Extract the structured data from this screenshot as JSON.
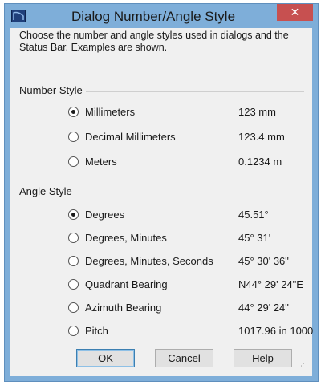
{
  "window": {
    "title": "Dialog Number/Angle Style",
    "close_label": "✕",
    "icon": "app-icon"
  },
  "description": "Choose the number and angle styles used in dialogs and the Status Bar.  Examples are shown.",
  "number_style": {
    "label": "Number Style",
    "options": [
      {
        "label": "Millimeters",
        "example": "123 mm",
        "selected": true
      },
      {
        "label": "Decimal Millimeters",
        "example": "123.4 mm",
        "selected": false
      },
      {
        "label": "Meters",
        "example": "0.1234 m",
        "selected": false
      }
    ]
  },
  "angle_style": {
    "label": "Angle Style",
    "options": [
      {
        "label": "Degrees",
        "example": "45.51°",
        "selected": true
      },
      {
        "label": "Degrees, Minutes",
        "example": "45° 31'",
        "selected": false
      },
      {
        "label": "Degrees, Minutes, Seconds",
        "example": "45° 30' 36\"",
        "selected": false
      },
      {
        "label": "Quadrant Bearing",
        "example": "N44° 29' 24\"E",
        "selected": false
      },
      {
        "label": "Azimuth Bearing",
        "example": "44° 29' 24\"",
        "selected": false
      },
      {
        "label": "Pitch",
        "example": "1017.96 in 1000",
        "selected": false
      }
    ]
  },
  "buttons": {
    "ok": "OK",
    "cancel": "Cancel",
    "help": "Help"
  },
  "colors": {
    "titlebar": "#7eaed9",
    "close": "#c75050",
    "client": "#f0f0f0"
  }
}
